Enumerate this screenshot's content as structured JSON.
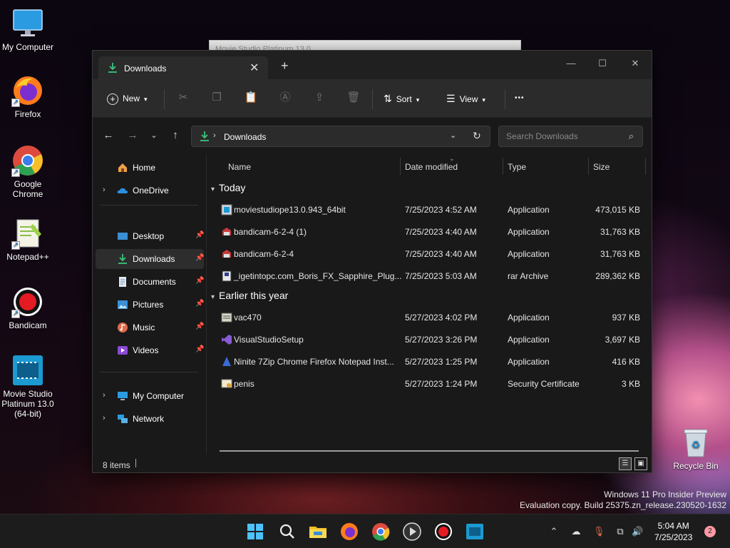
{
  "desktop": {
    "icons": [
      {
        "label": "My Computer"
      },
      {
        "label": "Firefox"
      },
      {
        "label": "Google Chrome"
      },
      {
        "label": "Notepad++"
      },
      {
        "label": "Bandicam"
      },
      {
        "label": "Movie Studio Platinum 13.0 (64-bit)"
      }
    ],
    "recycle_bin": "Recycle Bin",
    "watermark_line1": "Windows 11 Pro Insider Preview",
    "watermark_line2": "Evaluation copy. Build 25375.zn_release.230520-1632",
    "background_window_title": "Movie Studio Platinum 13.0"
  },
  "explorer": {
    "tab_title": "Downloads",
    "toolbar": {
      "new_label": "New",
      "sort_label": "Sort",
      "view_label": "View",
      "more_label": "•••"
    },
    "address": {
      "path": "Downloads"
    },
    "search": {
      "placeholder": "Search Downloads"
    },
    "sidebar": {
      "home": "Home",
      "onedrive": "OneDrive",
      "desktop": "Desktop",
      "downloads": "Downloads",
      "documents": "Documents",
      "pictures": "Pictures",
      "music": "Music",
      "videos": "Videos",
      "my_computer": "My Computer",
      "network": "Network"
    },
    "columns": {
      "name": "Name",
      "date": "Date modified",
      "type": "Type",
      "size": "Size"
    },
    "groups": {
      "today": "Today",
      "earlier": "Earlier this year"
    },
    "files_today": [
      {
        "name": "moviestudiope13.0.943_64bit",
        "date": "7/25/2023 4:52 AM",
        "type": "Application",
        "size": "473,015 KB"
      },
      {
        "name": "bandicam-6-2-4 (1)",
        "date": "7/25/2023 4:40 AM",
        "type": "Application",
        "size": "31,763 KB"
      },
      {
        "name": "bandicam-6-2-4",
        "date": "7/25/2023 4:40 AM",
        "type": "Application",
        "size": "31,763 KB"
      },
      {
        "name": "_igetintopc.com_Boris_FX_Sapphire_Plug...",
        "date": "7/25/2023 5:03 AM",
        "type": "rar Archive",
        "size": "289,362 KB"
      }
    ],
    "files_earlier": [
      {
        "name": "vac470",
        "date": "5/27/2023 4:02 PM",
        "type": "Application",
        "size": "937 KB"
      },
      {
        "name": "VisualStudioSetup",
        "date": "5/27/2023 3:26 PM",
        "type": "Application",
        "size": "3,697 KB"
      },
      {
        "name": "Ninite 7Zip Chrome Firefox Notepad Inst...",
        "date": "5/27/2023 1:25 PM",
        "type": "Application",
        "size": "416 KB"
      },
      {
        "name": "penis",
        "date": "5/27/2023 1:24 PM",
        "type": "Security Certificate",
        "size": "3 KB"
      }
    ],
    "status": "8 items"
  },
  "taskbar": {
    "time": "5:04 AM",
    "date": "7/25/2023",
    "notification_count": "2"
  }
}
